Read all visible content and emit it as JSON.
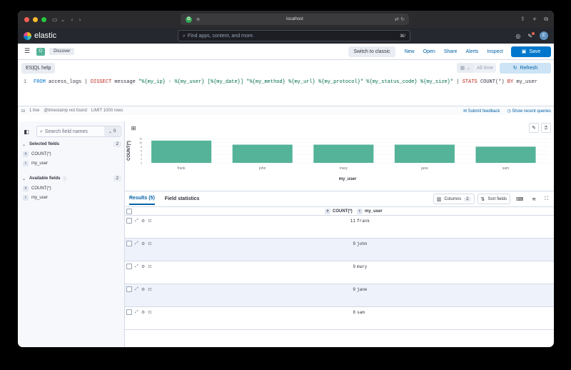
{
  "browser": {
    "url": "localhost"
  },
  "header": {
    "logo": "elastic",
    "search_placeholder": "Find apps, content, and more.",
    "search_shortcut": "⌘/",
    "avatar": "E"
  },
  "appbar": {
    "app_badge": "D",
    "breadcrumb": "Discover",
    "switch_classic": "Switch to classic",
    "links": [
      "New",
      "Open",
      "Share",
      "Alerts",
      "Inspect"
    ],
    "save": "Save"
  },
  "query": {
    "mode_label": "ES|QL help",
    "time_label": "All time",
    "refresh": "Refresh",
    "line_number": "1",
    "parts": {
      "from": "FROM",
      "index": " access_logs | ",
      "dissect": "DISSECT",
      "msg": " message ",
      "pattern": "\"%{my_ip} - %{my_user} [%{my_date}] \"%{my_method} %{my_url} %{my_protocol}\" %{my_status_code} %{my_size}\"",
      "pipe": " | ",
      "stats": "STATS",
      "fn": " COUNT(*) ",
      "by": "BY",
      "field": " my_user"
    },
    "status": {
      "lines": "1 line",
      "ts": "@timestamp not found",
      "limit": "LIMIT 1000 rows"
    },
    "submit_feedback": "Submit feedback",
    "show_recent": "Show recent queries"
  },
  "sidebar": {
    "search_placeholder": "Search field names",
    "filter_count": "0",
    "selected_title": "Selected fields",
    "selected_count": "2",
    "selected_fields": [
      {
        "type": "#",
        "name": "COUNT(*)"
      },
      {
        "type": "t",
        "name": "my_user"
      }
    ],
    "available_title": "Available fields",
    "available_count": "2",
    "available_fields": [
      {
        "type": "#",
        "name": "COUNT(*)"
      },
      {
        "type": "t",
        "name": "my_user"
      }
    ]
  },
  "chart_data": {
    "type": "bar",
    "categories": [
      "frank",
      "john",
      "mary",
      "jane",
      "sam"
    ],
    "values": [
      11,
      9,
      9,
      9,
      8
    ],
    "xlabel": "my_user",
    "ylabel": "COUNT(*)",
    "ylim": [
      0,
      12
    ],
    "yticks": [
      0,
      2,
      4,
      6,
      8,
      10,
      12
    ],
    "bar_color": "#54b399"
  },
  "results": {
    "tab_results": "Results (5)",
    "tab_stats": "Field statistics",
    "columns_label": "Columns",
    "columns_count": "2",
    "sort_label": "Sort fields",
    "col_count": "COUNT(*)",
    "col_user": "my_user",
    "rows": [
      {
        "count": "11",
        "user": "frank"
      },
      {
        "count": "9",
        "user": "john"
      },
      {
        "count": "9",
        "user": "mary"
      },
      {
        "count": "9",
        "user": "jane"
      },
      {
        "count": "8",
        "user": "sam"
      }
    ]
  }
}
